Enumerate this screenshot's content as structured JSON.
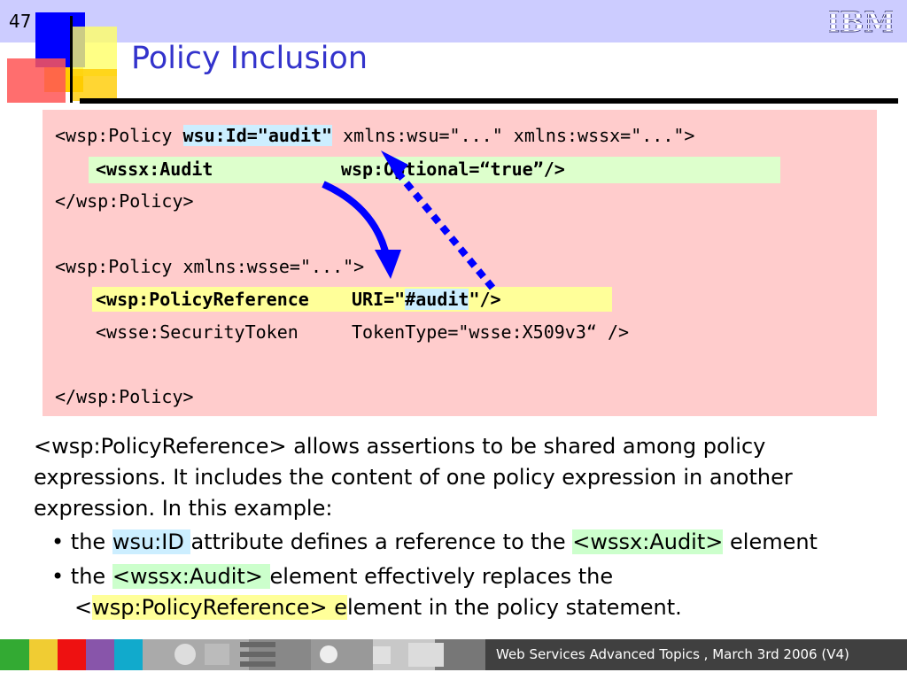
{
  "slide": {
    "number": "47",
    "title": "Policy Inclusion",
    "logo": "IBM"
  },
  "code": {
    "line1_a": "<wsp:Policy ",
    "line1_id": "wsu:Id=\"audit\"",
    "line1_b": " xmlns:wsu=\"...\" xmlns:wssx=\"...\">",
    "line2": "<wssx:Audit            wsp:Optional=“true”/>",
    "line3": "</wsp:Policy>",
    "line4": "<wsp:Policy xmlns:wsse=\"...\">",
    "line5_a": "<wsp:PolicyReference    URI=\"",
    "line5_ref": "#audit",
    "line5_b": "\"/>",
    "line6": "<wsse:SecurityToken     TokenType=\"wsse:X509v3“ />",
    "line7": "</wsp:Policy>"
  },
  "body": {
    "para": "<wsp:PolicyReference> allows assertions to be shared among policy expressions. It includes the content of one policy expression in another expression.  In this example:",
    "b1_pre": "the ",
    "b1_hl": "wsu:ID ",
    "b1_mid": "attribute defines a reference to the ",
    "b1_hl2": "<wssx:Audit>",
    "b1_post": " element",
    "b2_pre": "the ",
    "b2_hl": "<wssx:Audit> ",
    "b2_post": "element effectively replaces the",
    "b2_l2_pre": "<",
    "b2_l2_hl": "wsp:PolicyReference> e",
    "b2_l2_post": "lement in the policy statement.",
    "bullet_glyph": "•"
  },
  "footer": {
    "text": "Web Services Advanced Topics , March 3rd 2006 (V4)"
  },
  "colors": {
    "title": "#3333cc",
    "code_bg": "#ffcccc",
    "arrow": "#0000ff"
  }
}
